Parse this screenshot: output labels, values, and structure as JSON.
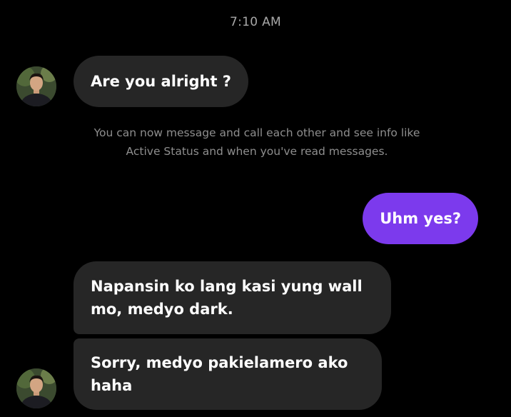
{
  "thread": {
    "timestamp": "7:10 AM",
    "notice": "You can now message and call each other and see info like Active Status and when you've read messages.",
    "messages": [
      {
        "sender": "them",
        "text": "Are you alright ?"
      },
      {
        "sender": "me",
        "text": "Uhm yes?"
      },
      {
        "sender": "them",
        "text": "Napansin ko lang kasi yung wall mo, medyo dark."
      },
      {
        "sender": "them",
        "text": "Sorry, medyo pakielamero ako haha"
      }
    ]
  },
  "colors": {
    "background": "#000000",
    "incoming_bubble": "#262626",
    "outgoing_bubble": "#7c3aed",
    "notice_text": "#8e8e8e",
    "timestamp_text": "#a8a8a8"
  },
  "icons": {
    "avatar": "contact-avatar-photo"
  }
}
